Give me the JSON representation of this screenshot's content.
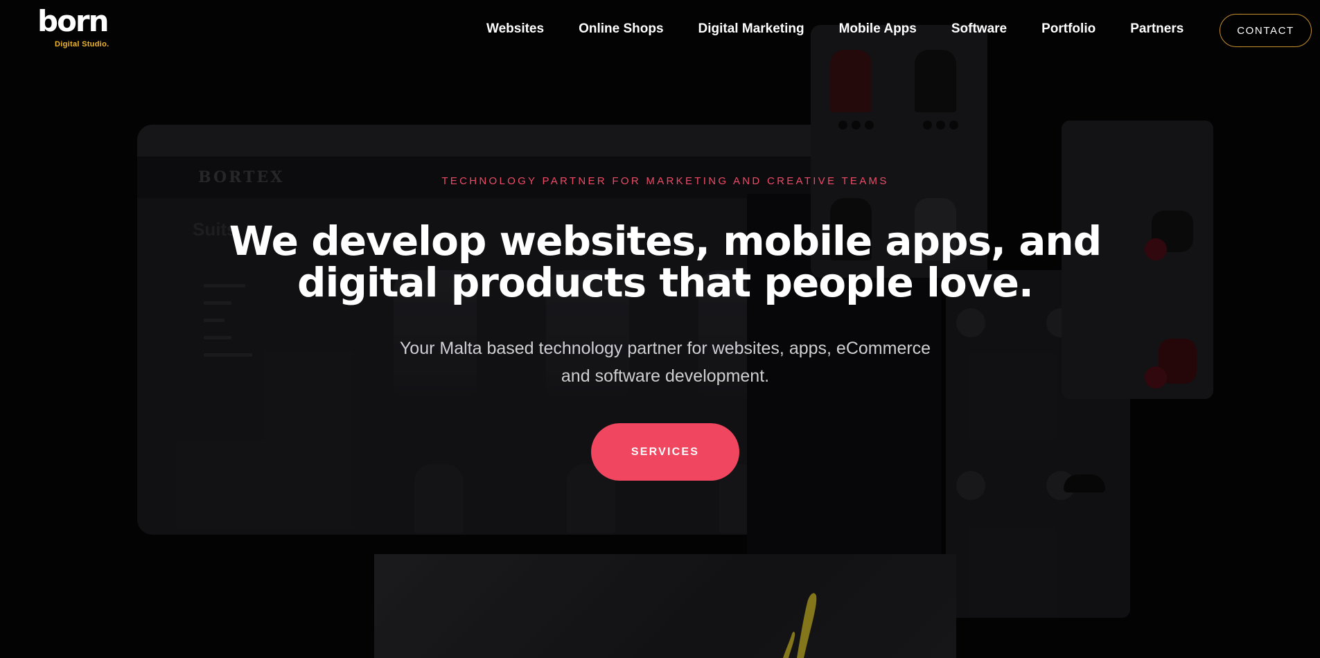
{
  "brand": {
    "logo_text": "born",
    "tagline": "Digital Studio.",
    "accent_color": "#f3b72b"
  },
  "nav": {
    "items": [
      {
        "label": "Websites"
      },
      {
        "label": "Online Shops"
      },
      {
        "label": "Digital Marketing"
      },
      {
        "label": "Mobile Apps"
      },
      {
        "label": "Software"
      },
      {
        "label": "Portfolio"
      },
      {
        "label": "Partners"
      }
    ],
    "contact_label": "CONTACT",
    "contact_border_color": "#c8902a"
  },
  "hero": {
    "eyebrow": "TECHNOLOGY PARTNER FOR MARKETING AND CREATIVE TEAMS",
    "headline_line1": "We develop websites, mobile apps, and",
    "headline_line2": "digital products that people love.",
    "subtitle_line1": "Your Malta based technology partner for websites, apps, eCommerce",
    "subtitle_line2": "and software development.",
    "cta_label": "SERVICES",
    "cta_color": "#f0465f",
    "eyebrow_color": "#ee4b68"
  },
  "background_mockup": {
    "store_name": "BORTEX",
    "category_title": "Suits"
  }
}
